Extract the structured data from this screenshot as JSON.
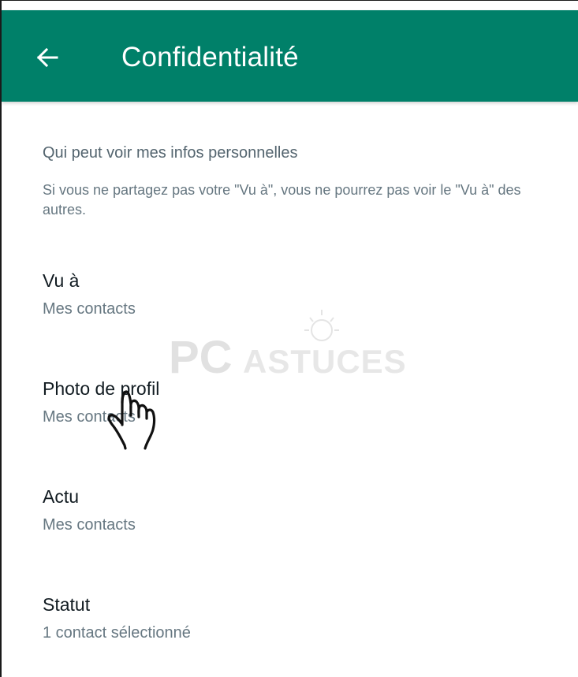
{
  "appbar": {
    "title": "Confidentialité",
    "back_icon": "arrow-left-icon",
    "color": "#008069"
  },
  "section": {
    "header": "Qui peut voir mes infos personnelles",
    "note": "Si vous ne partagez pas votre \"Vu à\", vous ne pourrez pas voir le \"Vu à\" des autres."
  },
  "items": [
    {
      "title": "Vu à",
      "value": "Mes contacts"
    },
    {
      "title": "Photo de profil",
      "value": "Mes contacts"
    },
    {
      "title": "Actu",
      "value": "Mes contacts"
    },
    {
      "title": "Statut",
      "value": "1 contact sélectionné"
    }
  ],
  "overlay": {
    "watermark_text": "PC ASTUCES",
    "watermark_icon": "lightbulb-icon",
    "cursor_icon": "hand-pointer-icon"
  }
}
